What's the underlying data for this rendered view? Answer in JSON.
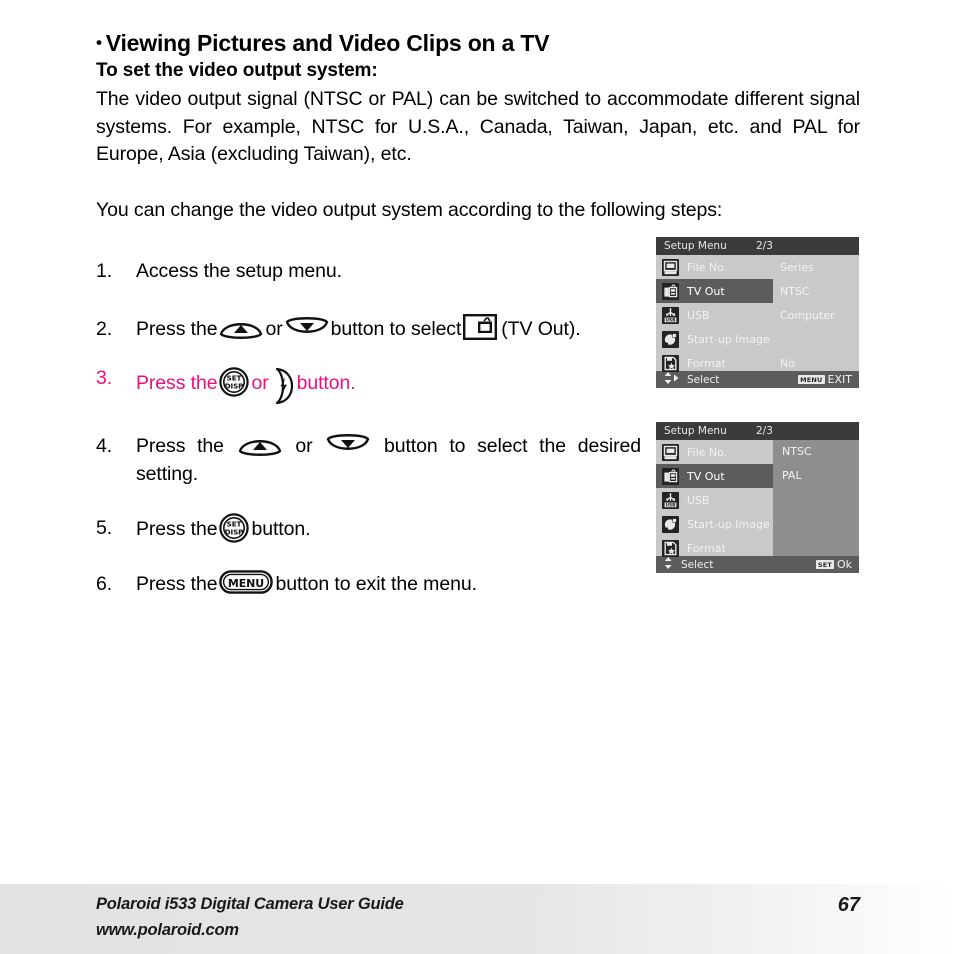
{
  "document": {
    "section_bullet": "•",
    "section_title": "Viewing Pictures and Video Clips on a TV",
    "sub_title": "To set the video output system:",
    "intro_paragraph": "The video output signal (NTSC or PAL) can be switched to accommodate different signal systems. For example, NTSC for U.S.A., Canada, Taiwan, Japan, etc. and PAL for Europe, Asia (excluding Taiwan), etc.",
    "lead_in_paragraph": "You can change the video output system according to the following steps:"
  },
  "steps": [
    {
      "number": "1.",
      "text_before": "Access the setup menu.",
      "text_middle": "",
      "text_after": ""
    },
    {
      "number": "2.",
      "text_before": "Press the",
      "or_label": "or",
      "text_middle": "button to select",
      "text_after": "(TV Out)."
    },
    {
      "number": "3.",
      "text_before": "Press the",
      "or_label": "or",
      "text_after": "button."
    },
    {
      "number": "4.",
      "text_before": "Press the",
      "or_label": "or",
      "text_after": "button to select the desired setting."
    },
    {
      "number": "5.",
      "text_before": "Press the",
      "text_after": "button."
    },
    {
      "number": "6.",
      "text_before": "Press the",
      "text_after": "button to exit the menu."
    }
  ],
  "button_labels": {
    "set_top": "SET",
    "set_bottom": "DISP",
    "menu": "MENU"
  },
  "colors": {
    "highlight_pink": "#ec1080",
    "lcd_header_bg": "#3b3b3b",
    "lcd_body_bg": "#c9c9c9",
    "lcd_selected_bg": "#5c5c5c",
    "lcd_submenu_bg": "#8e8e8e",
    "lcd_icon_bg": "#232323",
    "footer_bg": "#e2e2e2"
  },
  "lcd_screen_1": {
    "header_title": "Setup Menu",
    "header_page": "2/3",
    "rows": [
      {
        "icon": "file-number-icon",
        "label": "File No.",
        "value": "Series",
        "selected": false
      },
      {
        "icon": "tv-out-icon",
        "label": "TV Out",
        "value": "NTSC",
        "selected": true
      },
      {
        "icon": "usb-icon",
        "label": "USB",
        "value": "Computer",
        "selected": false
      },
      {
        "icon": "startup-image-icon",
        "label": "Start-up Image",
        "value": "",
        "selected": false
      },
      {
        "icon": "format-icon",
        "label": "Format",
        "value": "No",
        "selected": false
      }
    ],
    "footer": {
      "nav_hint": "Select",
      "action_badge": "MENU",
      "action_label": "EXIT",
      "has_right_arrow": true
    }
  },
  "lcd_screen_2": {
    "header_title": "Setup Menu",
    "header_page": "2/3",
    "rows": [
      {
        "icon": "file-number-icon",
        "label": "File No.",
        "selected": false
      },
      {
        "icon": "tv-out-icon",
        "label": "TV Out",
        "selected": true
      },
      {
        "icon": "usb-icon",
        "label": "USB",
        "selected": false
      },
      {
        "icon": "startup-image-icon",
        "label": "Start-up Image",
        "selected": false
      },
      {
        "icon": "format-icon",
        "label": "Format",
        "selected": false
      }
    ],
    "submenu_options": [
      "NTSC",
      "PAL"
    ],
    "footer": {
      "nav_hint": "Select",
      "action_badge": "SET",
      "action_label": "Ok",
      "has_right_arrow": false
    }
  },
  "footer": {
    "line1": "Polaroid i533 Digital Camera User Guide",
    "line2": "www.polaroid.com",
    "page_number": "67"
  }
}
